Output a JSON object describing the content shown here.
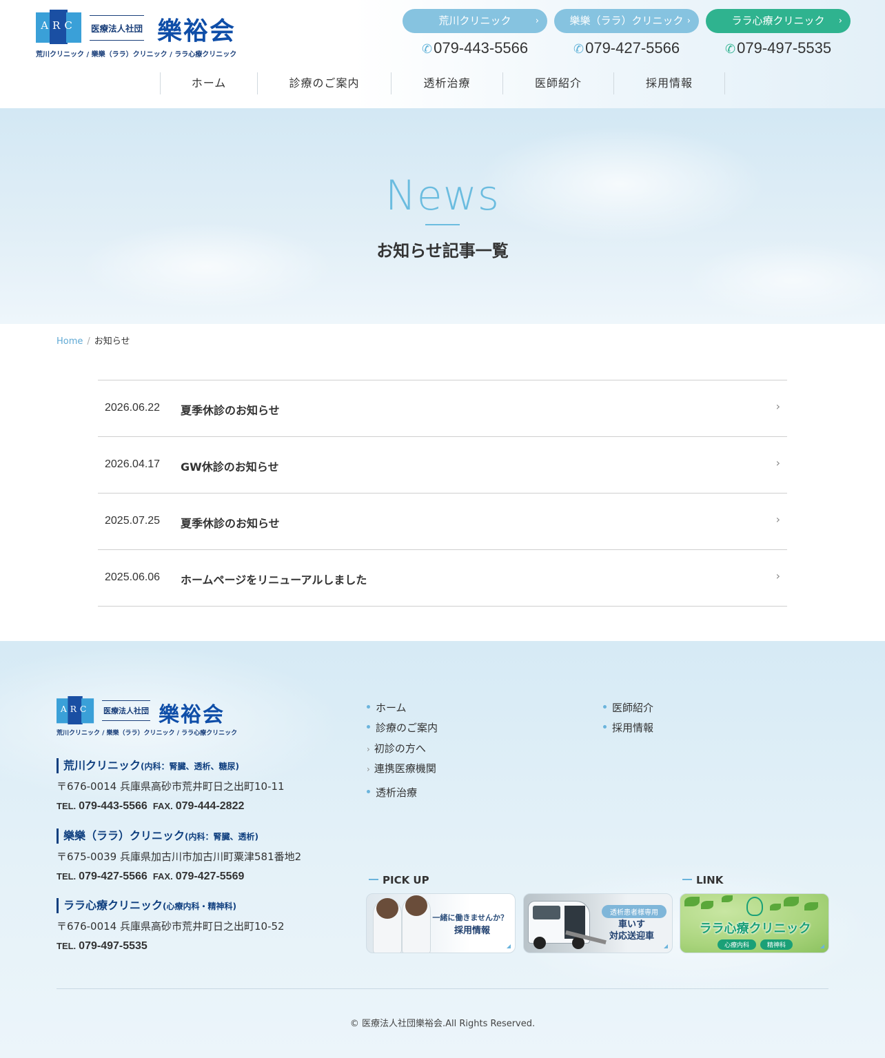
{
  "header": {
    "logo": {
      "mark_letters": "ARC",
      "corp_type": "医療法人社団",
      "name": "樂裕会",
      "clinics_line": "荒川クリニック / 樂樂（ララ）クリニック / ララ心療クリニック"
    },
    "clinic_buttons": [
      {
        "label": "荒川クリニック",
        "tel": "079-443-5566",
        "color": "#86c3e0"
      },
      {
        "label": "樂樂（ララ）クリニック",
        "tel": "079-427-5566",
        "color": "#86c3e0"
      },
      {
        "label": "ララ心療クリニック",
        "tel": "079-497-5535",
        "color": "#2fb38f"
      }
    ],
    "nav": [
      "ホーム",
      "診療のご案内",
      "透析治療",
      "医師紹介",
      "採用情報"
    ]
  },
  "hero": {
    "title": "News",
    "subtitle": "お知らせ記事一覧"
  },
  "breadcrumb": {
    "home": "Home",
    "separator": "/",
    "current": "お知らせ"
  },
  "news": [
    {
      "date": "2026.06.22",
      "title": "夏季休診のお知らせ"
    },
    {
      "date": "2026.04.17",
      "title": "GW休診のお知らせ"
    },
    {
      "date": "2025.07.25",
      "title": "夏季休診のお知らせ"
    },
    {
      "date": "2025.06.06",
      "title": "ホームページをリニューアルしました"
    }
  ],
  "footer": {
    "clinics": [
      {
        "name": "荒川クリニック",
        "dept": "(内科：腎臓、透析、糖尿)",
        "address": "〒676-0014  兵庫県高砂市荒井町日之出町10-11",
        "tel_label": "TEL.",
        "tel": "079-443-5566",
        "fax_label": "FAX.",
        "fax": "079-444-2822"
      },
      {
        "name": "樂樂（ララ）クリニック",
        "dept": "(内科：腎臓、透析)",
        "address": "〒675-0039  兵庫県加古川市加古川町粟津581番地2",
        "tel_label": "TEL.",
        "tel": "079-427-5566",
        "fax_label": "FAX.",
        "fax": "079-427-5569"
      },
      {
        "name": "ララ心療クリニック",
        "dept": "(心療内科・精神科)",
        "address": "〒676-0014  兵庫県高砂市荒井町日之出町10-52",
        "tel_label": "TEL.",
        "tel": "079-497-5535"
      }
    ],
    "nav_col1": [
      {
        "label": "ホーム",
        "type": "dot"
      },
      {
        "label": "診療のご案内",
        "type": "dot"
      },
      {
        "label": "初診の方へ",
        "type": "arrow"
      },
      {
        "label": "連携医療機関",
        "type": "arrow"
      },
      {
        "label": "透析治療",
        "type": "dot"
      }
    ],
    "nav_col2": [
      {
        "label": "医師紹介",
        "type": "dot"
      },
      {
        "label": "採用情報",
        "type": "dot"
      }
    ],
    "pickup_label": "PICK UP",
    "link_label": "LINK",
    "banners": {
      "recruit": {
        "line1": "一緒に働きませんか？",
        "line2": "採用情報"
      },
      "wheelchair": {
        "pill": "透析患者様専用",
        "line1": "車いす",
        "line2": "対応送迎車"
      },
      "lala": {
        "title": "ララ心療クリニック",
        "tag1": "心療内科",
        "tag2": "精神科"
      }
    },
    "copyright": "© 医療法人社団樂裕会.All Rights Reserved."
  },
  "colors": {
    "brand_navy": "#0f4ea8",
    "accent_blue": "#6bbcdf",
    "accent_green": "#2fb38f"
  },
  "icons": {
    "phone": "phone-icon",
    "chevron": "chevron-right-icon"
  }
}
